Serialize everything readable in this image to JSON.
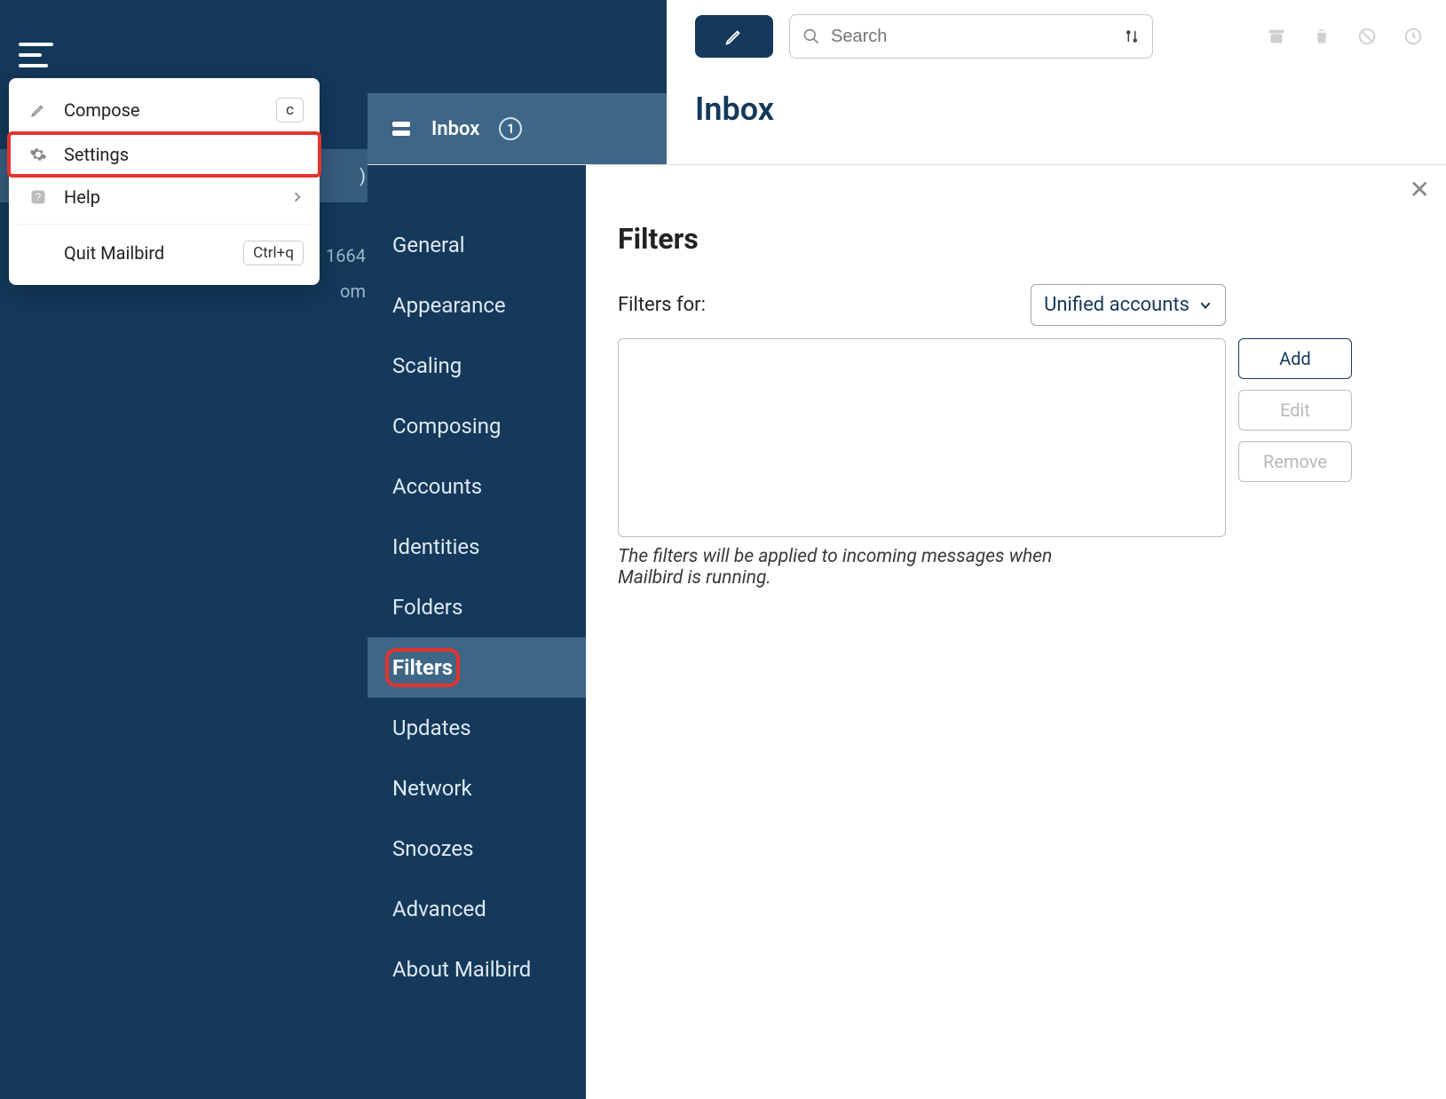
{
  "left_col": {
    "folder_selected_tail": ")",
    "below_text_1": "1664",
    "below_text_2": "om"
  },
  "app_menu": {
    "compose": {
      "label": "Compose",
      "key": "c"
    },
    "settings": {
      "label": "Settings"
    },
    "help": {
      "label": "Help"
    },
    "quit": {
      "label": "Quit Mailbird",
      "key": "Ctrl+q"
    }
  },
  "mid": {
    "inbox_label": "Inbox",
    "inbox_count": "1"
  },
  "toolbar": {
    "search_placeholder": "Search"
  },
  "page": {
    "title": "Inbox"
  },
  "settings_nav": [
    {
      "label": "General"
    },
    {
      "label": "Appearance"
    },
    {
      "label": "Scaling"
    },
    {
      "label": "Composing"
    },
    {
      "label": "Accounts"
    },
    {
      "label": "Identities"
    },
    {
      "label": "Folders"
    },
    {
      "label": "Filters",
      "active": true,
      "highlight": true
    },
    {
      "label": "Updates"
    },
    {
      "label": "Network"
    },
    {
      "label": "Snoozes"
    },
    {
      "label": "Advanced"
    },
    {
      "label": "About Mailbird"
    }
  ],
  "settings_body": {
    "heading": "Filters",
    "filters_for_label": "Filters for:",
    "dropdown_value": "Unified accounts",
    "buttons": {
      "add": "Add",
      "edit": "Edit",
      "remove": "Remove"
    },
    "hint": "The filters will be applied to incoming messages when Mailbird is running."
  }
}
